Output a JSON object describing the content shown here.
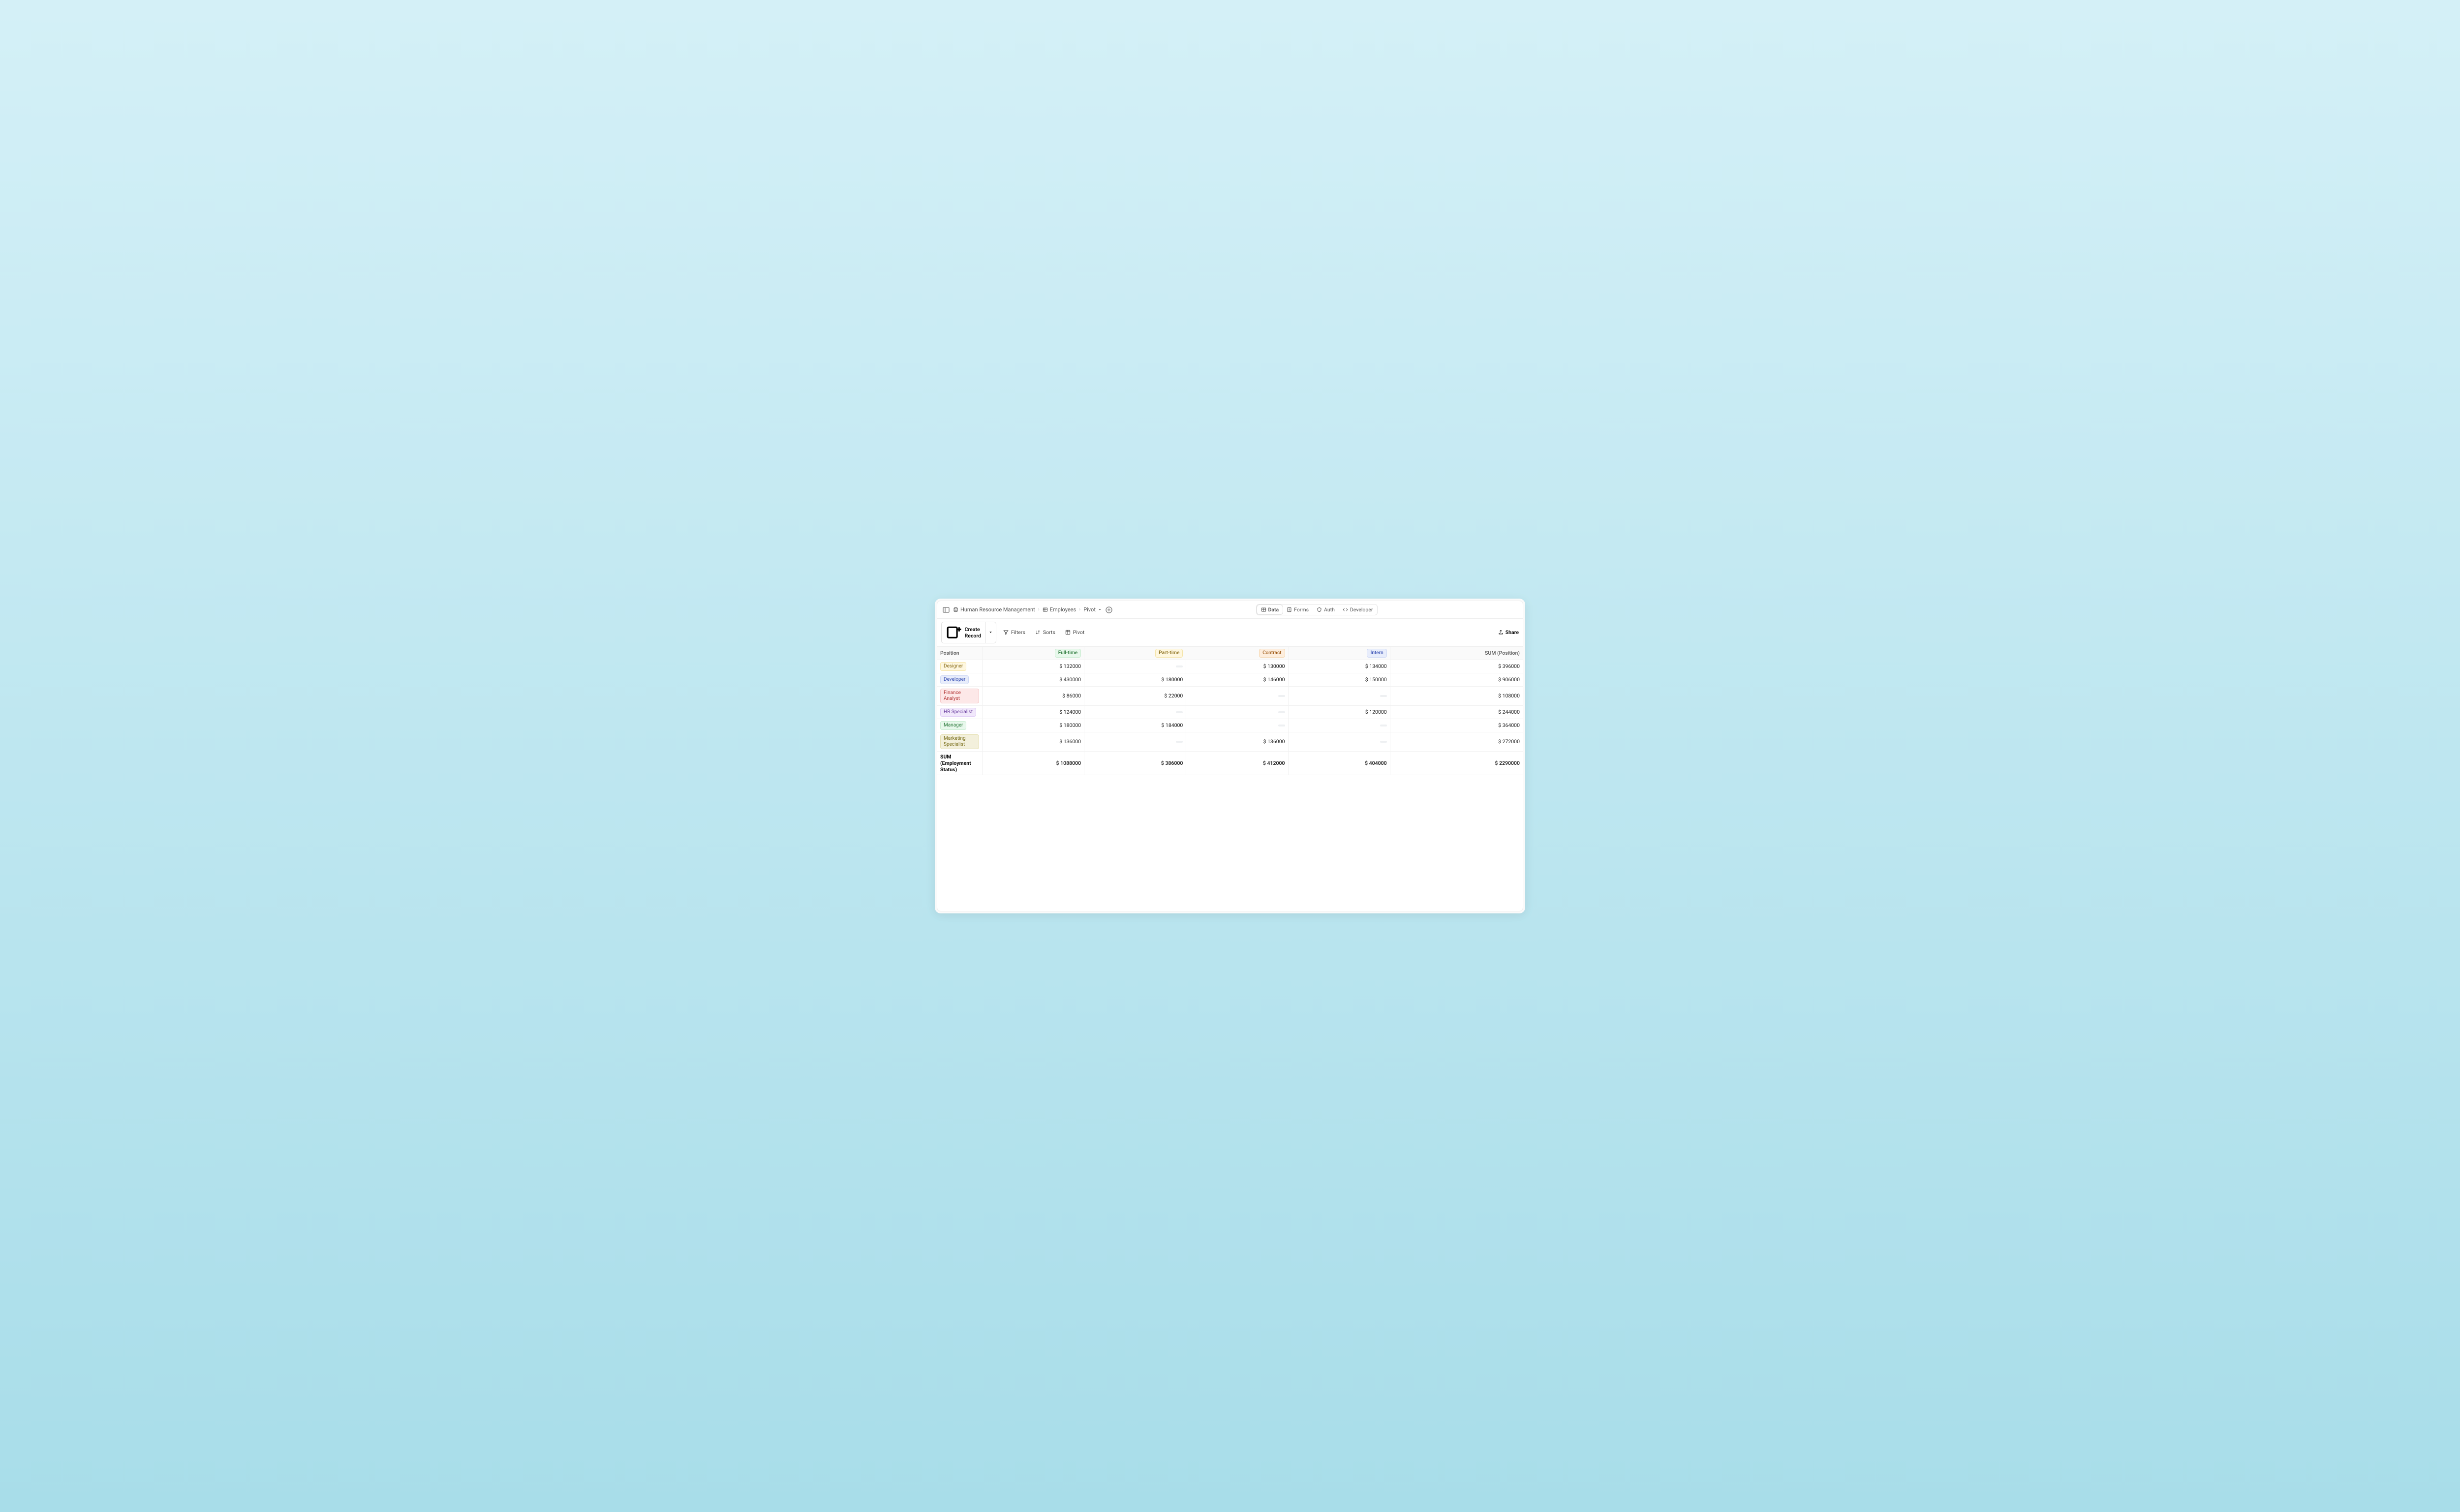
{
  "breadcrumb": {
    "base": "Human Resource Management",
    "table": "Employees",
    "view": "Pivot"
  },
  "tabs": {
    "data": "Data",
    "forms": "Forms",
    "auth": "Auth",
    "developer": "Developer"
  },
  "toolbar": {
    "create": "Create Record",
    "filters": "Filters",
    "sorts": "Sorts",
    "pivot": "Pivot",
    "share": "Share"
  },
  "pivot": {
    "row_label": "Position",
    "sum_col": "SUM (Position)",
    "sum_row": "SUM (Employment Status)",
    "columns": [
      {
        "label": "Full-time",
        "badge": "green"
      },
      {
        "label": "Part-time",
        "badge": "yellow"
      },
      {
        "label": "Contract",
        "badge": "orange"
      },
      {
        "label": "Intern",
        "badge": "blue"
      }
    ],
    "rows": [
      {
        "label": "Designer",
        "badge": "yellow",
        "values": [
          "$ 132000",
          null,
          "$ 130000",
          "$ 134000"
        ],
        "sum": "$ 396000"
      },
      {
        "label": "Developer",
        "badge": "blue",
        "values": [
          "$ 430000",
          "$ 180000",
          "$ 146000",
          "$ 150000"
        ],
        "sum": "$ 906000"
      },
      {
        "label": "Finance Analyst",
        "badge": "red",
        "values": [
          "$ 86000",
          "$ 22000",
          null,
          null
        ],
        "sum": "$ 108000"
      },
      {
        "label": "HR Specialist",
        "badge": "purple",
        "values": [
          "$ 124000",
          null,
          null,
          "$ 120000"
        ],
        "sum": "$ 244000"
      },
      {
        "label": "Manager",
        "badge": "green",
        "values": [
          "$ 180000",
          "$ 184000",
          null,
          null
        ],
        "sum": "$ 364000"
      },
      {
        "label": "Marketing Specialist",
        "badge": "olive",
        "values": [
          "$ 136000",
          null,
          "$ 136000",
          null
        ],
        "sum": "$ 272000"
      }
    ],
    "totals": {
      "values": [
        "$ 1088000",
        "$ 386000",
        "$ 412000",
        "$ 404000"
      ],
      "sum": "$ 2290000"
    }
  },
  "chart_data": {
    "type": "table",
    "title": "Pivot: SUM of Salary by Position × Employment Status",
    "row_dimension": "Position",
    "column_dimension": "Employment Status",
    "columns": [
      "Full-time",
      "Part-time",
      "Contract",
      "Intern"
    ],
    "rows": [
      {
        "position": "Designer",
        "Full-time": 132000,
        "Part-time": null,
        "Contract": 130000,
        "Intern": 134000,
        "sum": 396000
      },
      {
        "position": "Developer",
        "Full-time": 430000,
        "Part-time": 180000,
        "Contract": 146000,
        "Intern": 150000,
        "sum": 906000
      },
      {
        "position": "Finance Analyst",
        "Full-time": 86000,
        "Part-time": 22000,
        "Contract": null,
        "Intern": null,
        "sum": 108000
      },
      {
        "position": "HR Specialist",
        "Full-time": 124000,
        "Part-time": null,
        "Contract": null,
        "Intern": 120000,
        "sum": 244000
      },
      {
        "position": "Manager",
        "Full-time": 180000,
        "Part-time": 184000,
        "Contract": null,
        "Intern": null,
        "sum": 364000
      },
      {
        "position": "Marketing Specialist",
        "Full-time": 136000,
        "Part-time": null,
        "Contract": 136000,
        "Intern": null,
        "sum": 272000
      }
    ],
    "column_totals": {
      "Full-time": 1088000,
      "Part-time": 386000,
      "Contract": 412000,
      "Intern": 404000
    },
    "grand_total": 2290000
  }
}
